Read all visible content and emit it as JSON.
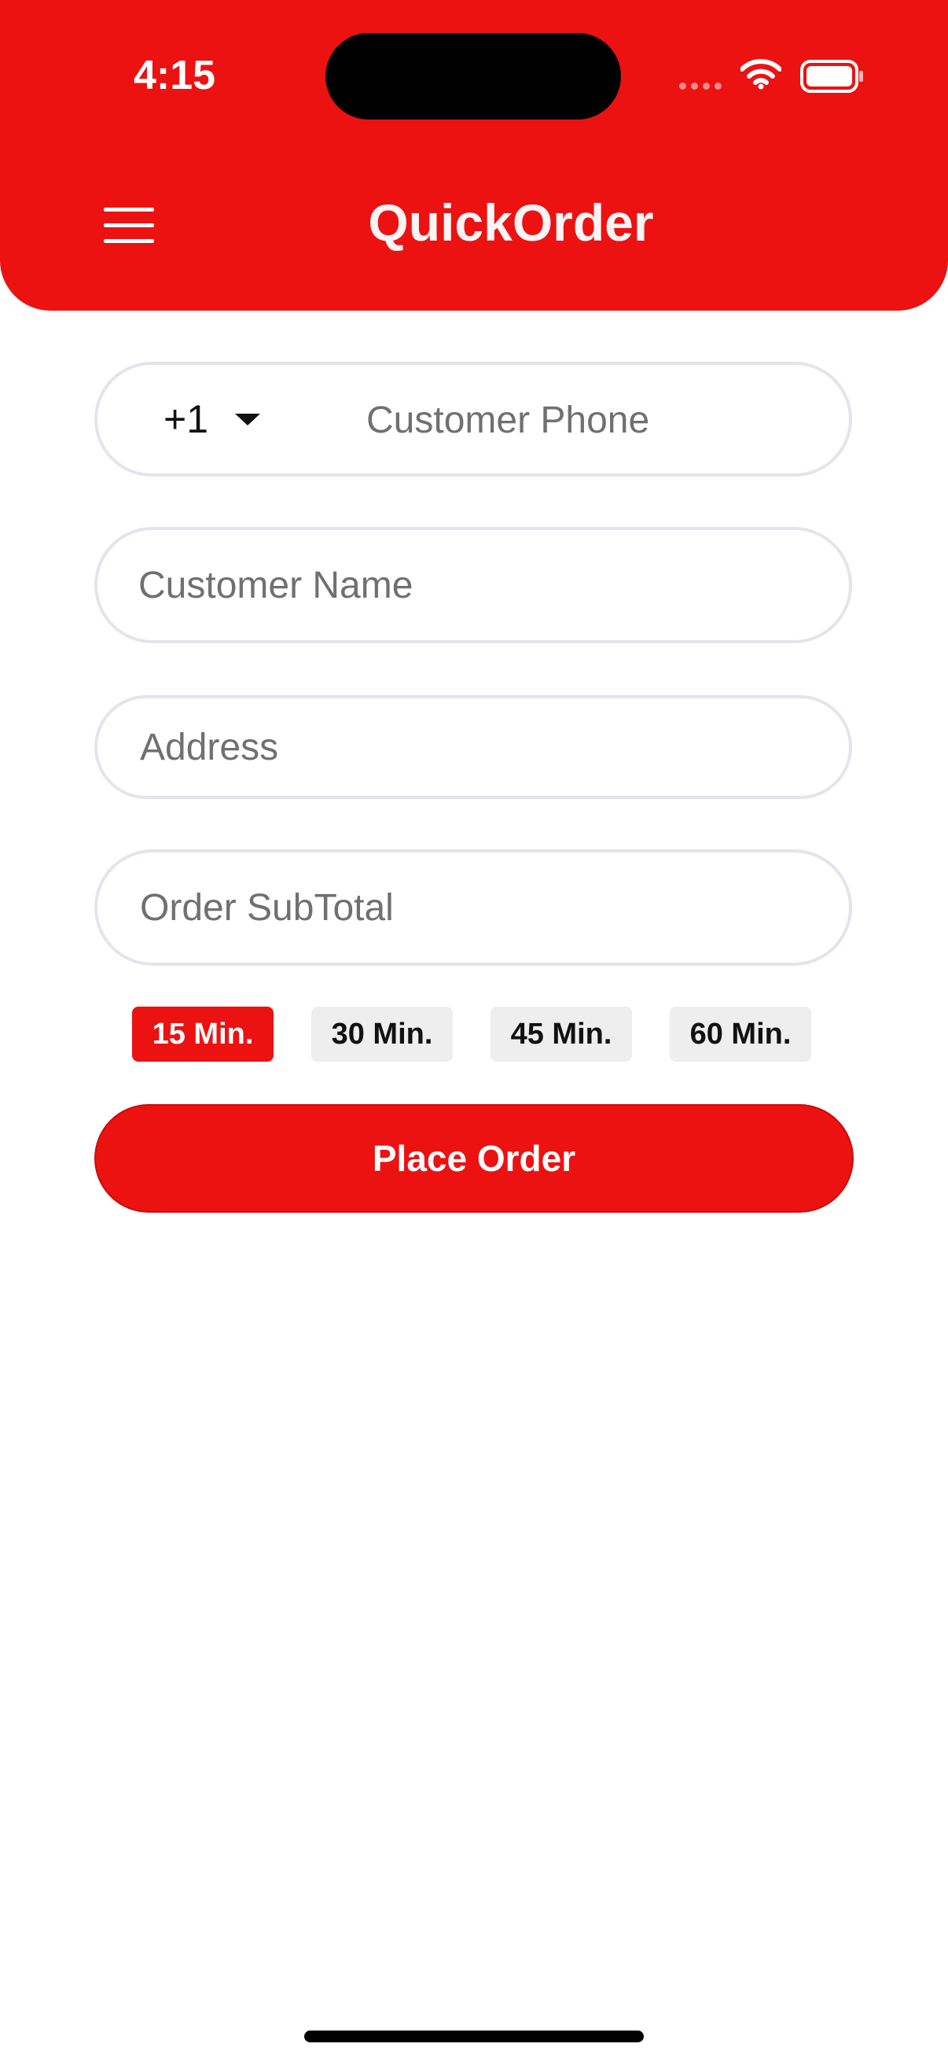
{
  "status_bar": {
    "time": "4:15"
  },
  "header": {
    "title": "QuickOrder"
  },
  "form": {
    "country_code": "+1",
    "phone_placeholder": "Customer Phone",
    "name_placeholder": "Customer Name",
    "address_placeholder": "Address",
    "subtotal_placeholder": "Order SubTotal"
  },
  "time_options": [
    {
      "label": "15 Min.",
      "selected": true
    },
    {
      "label": "30 Min.",
      "selected": false
    },
    {
      "label": "45 Min.",
      "selected": false
    },
    {
      "label": "60 Min.",
      "selected": false
    }
  ],
  "submit_label": "Place Order",
  "colors": {
    "accent": "#EC1212",
    "chip_bg": "#EEEEEE",
    "field_border": "#E4E4EE"
  }
}
